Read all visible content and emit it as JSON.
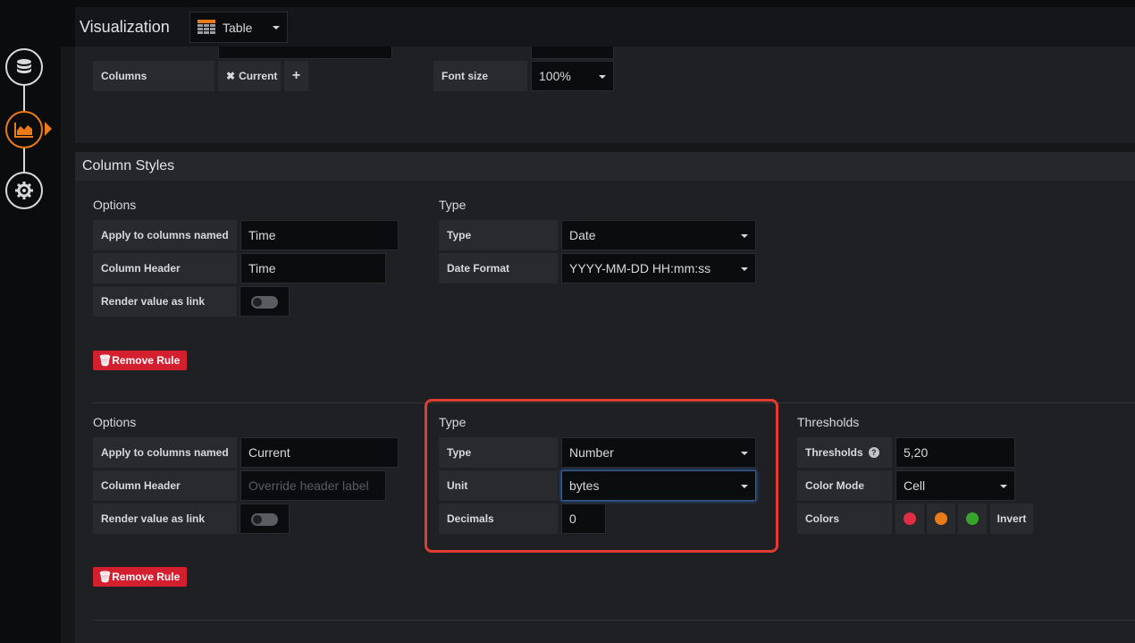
{
  "header": {
    "title": "Visualization",
    "vis_type": "Table"
  },
  "nav": {
    "steps": [
      "queries-icon",
      "visualization-icon",
      "general-icon"
    ]
  },
  "top_options": {
    "columns_label": "Columns",
    "column_tag": "Current",
    "font_size_label": "Font size",
    "font_size_value": "100%"
  },
  "column_styles": {
    "title": "Column Styles",
    "rule1": {
      "options_title": "Options",
      "apply_label": "Apply to columns named",
      "apply_value": "Time",
      "header_label": "Column Header",
      "header_value": "Time",
      "link_label": "Render value as link",
      "type_title": "Type",
      "type_label": "Type",
      "type_value": "Date",
      "date_format_label": "Date Format",
      "date_format_value": "YYYY-MM-DD HH:mm:ss",
      "remove_label": "Remove Rule"
    },
    "rule2": {
      "options_title": "Options",
      "apply_label": "Apply to columns named",
      "apply_value": "Current",
      "header_label": "Column Header",
      "header_placeholder": "Override header label",
      "link_label": "Render value as link",
      "type_title": "Type",
      "type_label": "Type",
      "type_value": "Number",
      "unit_label": "Unit",
      "unit_value": "bytes",
      "decimals_label": "Decimals",
      "decimals_value": "0",
      "thresholds_title": "Thresholds",
      "thresholds_label": "Thresholds",
      "thresholds_value": "5,20",
      "color_mode_label": "Color Mode",
      "color_mode_value": "Cell",
      "colors_label": "Colors",
      "colors": [
        "#e02f44",
        "#eb7b18",
        "#37a52b"
      ],
      "invert_label": "Invert",
      "remove_label": "Remove Rule"
    }
  }
}
